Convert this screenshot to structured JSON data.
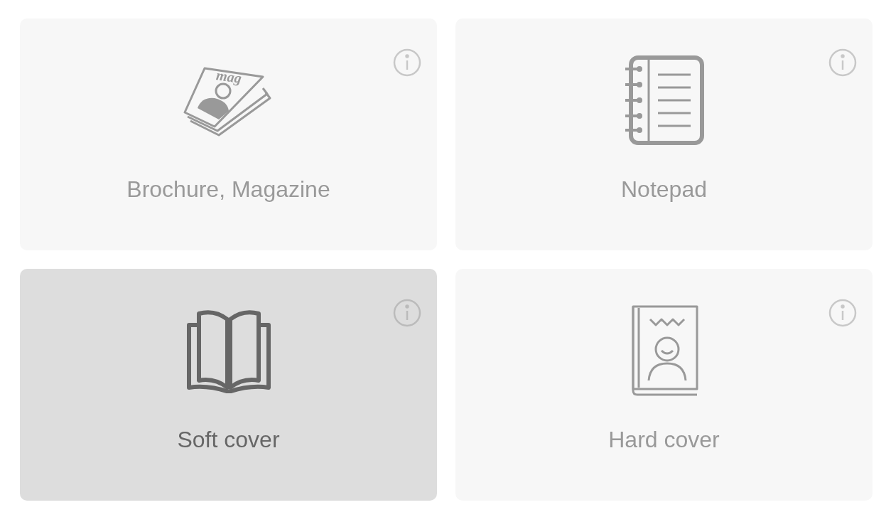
{
  "cards": [
    {
      "kind": "magazine",
      "label": "Brochure, Magazine",
      "icon_text": "mag",
      "selected": false
    },
    {
      "kind": "notepad",
      "label": "Notepad",
      "selected": false
    },
    {
      "kind": "softcover",
      "label": "Soft cover",
      "selected": true
    },
    {
      "kind": "hardcover",
      "label": "Hard cover",
      "selected": false
    }
  ]
}
